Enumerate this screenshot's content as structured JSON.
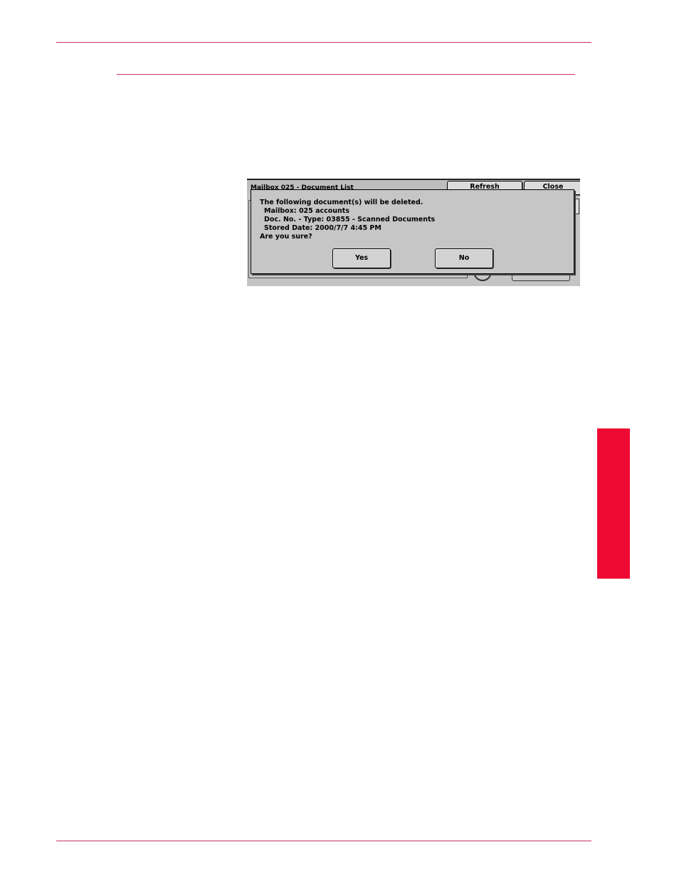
{
  "screen": {
    "window_title": "Mailbox 025 - Document List",
    "refresh_label": "Refresh",
    "close_label": "Close"
  },
  "dialog": {
    "line1": "The following document(s) will be deleted.",
    "line2": "Mailbox: 025 accounts",
    "line3": "Doc. No. - Type: 03855 - Scanned Documents",
    "line4": "Stored Date: 2000/7/7 4:45 PM",
    "line5": "Are you sure?",
    "yes_label": "Yes",
    "no_label": "No"
  },
  "colors": {
    "rule": "#c8336a",
    "side_tab": "#ee0a33",
    "screen_bg": "#c4c4c4"
  }
}
